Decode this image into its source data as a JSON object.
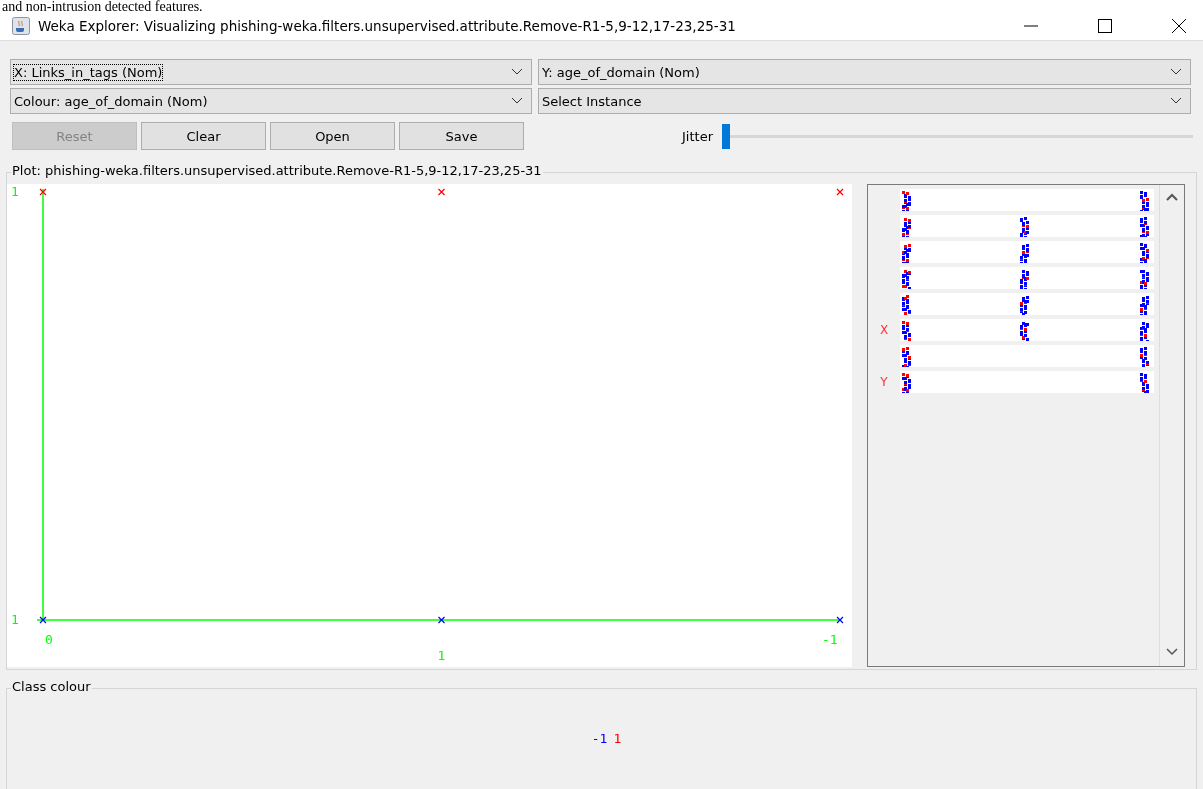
{
  "document_fragment": "and non-intrusion detected features.",
  "window": {
    "title": "Weka Explorer: Visualizing phishing-weka.filters.unsupervised.attribute.Remove-R1-5,9-12,17-23,25-31"
  },
  "selectors": [
    {
      "value": "X: Links_in_tags (Nom)",
      "selected": true
    },
    {
      "value": "Y: age_of_domain (Nom)",
      "selected": false
    },
    {
      "value": "Colour: age_of_domain (Nom)",
      "selected": false
    },
    {
      "value": "Select Instance",
      "selected": false
    }
  ],
  "buttons": [
    {
      "label": "Reset",
      "disabled": true
    },
    {
      "label": "Clear",
      "disabled": false
    },
    {
      "label": "Open",
      "disabled": false
    },
    {
      "label": "Save",
      "disabled": false
    }
  ],
  "jitter": {
    "label": "Jitter",
    "level": 0
  },
  "plot": {
    "title": "Plot: phishing-weka.filters.unsupervised.attribute.Remove-R1-5,9-12,17-23,25-31",
    "x_labels": [
      "0",
      "1",
      "-1"
    ],
    "y_labels": [
      "1",
      "1"
    ]
  },
  "attribute_bars": [
    {
      "kind": "two-cluster"
    },
    {
      "kind": "three-cluster"
    },
    {
      "kind": "three-cluster"
    },
    {
      "kind": "three-cluster"
    },
    {
      "kind": "three-cluster"
    },
    {
      "kind": "three-cluster",
      "marker": "X"
    },
    {
      "kind": "two-cluster"
    },
    {
      "kind": "two-cluster",
      "marker": "Y"
    }
  ],
  "class_colour": {
    "title": "Class colour",
    "classes": [
      {
        "label": "-1",
        "color": "#0000ff"
      },
      {
        "label": "1",
        "color": "#ff0000"
      }
    ]
  }
}
